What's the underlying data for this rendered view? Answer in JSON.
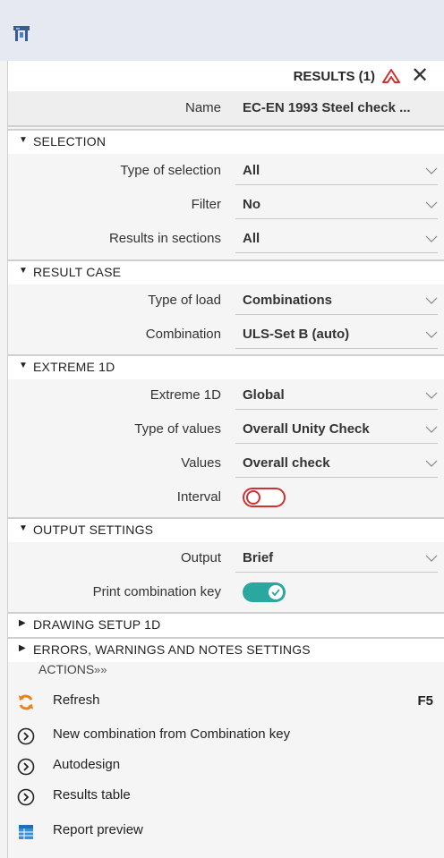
{
  "panel": {
    "title": "RESULTS (1)",
    "name_label": "Name",
    "name_value": "EC-EN 1993 Steel check ..."
  },
  "sections": {
    "selection": "SELECTION",
    "result_case": "RESULT CASE",
    "extreme_1d": "EXTREME 1D",
    "output_settings": "OUTPUT SETTINGS",
    "drawing_setup": "DRAWING SETUP 1D",
    "errors_warnings": "ERRORS, WARNINGS AND NOTES SETTINGS"
  },
  "selection": {
    "type_of_selection": {
      "label": "Type of selection",
      "value": "All"
    },
    "filter": {
      "label": "Filter",
      "value": "No"
    },
    "results_in_sections": {
      "label": "Results in sections",
      "value": "All"
    }
  },
  "result_case": {
    "type_of_load": {
      "label": "Type of load",
      "value": "Combinations"
    },
    "combination": {
      "label": "Combination",
      "value": "ULS-Set B (auto)"
    }
  },
  "extreme": {
    "extreme_1d": {
      "label": "Extreme 1D",
      "value": "Global"
    },
    "type_of_values": {
      "label": "Type of values",
      "value": "Overall Unity Check"
    },
    "values": {
      "label": "Values",
      "value": "Overall check"
    },
    "interval": {
      "label": "Interval",
      "on": false
    }
  },
  "output": {
    "output": {
      "label": "Output",
      "value": "Brief"
    },
    "print_combination_key": {
      "label": "Print combination key",
      "on": true
    }
  },
  "actions": {
    "label": "ACTIONS",
    "chevron": "»»",
    "items": [
      {
        "label": "Refresh",
        "icon": "refresh-icon",
        "key": "F5"
      },
      {
        "label": "New combination from Combination key",
        "icon": "circle-chevron-icon"
      },
      {
        "label": "Autodesign",
        "icon": "circle-chevron-icon"
      },
      {
        "label": "Results table",
        "icon": "circle-chevron-icon"
      },
      {
        "label": "Report preview",
        "icon": "table-icon"
      }
    ]
  },
  "colors": {
    "accent_red": "#d0302f",
    "toggle_on": "#2aa8a0",
    "refresh_orange": "#e8821e",
    "report_blue": "#3a8fd8"
  }
}
